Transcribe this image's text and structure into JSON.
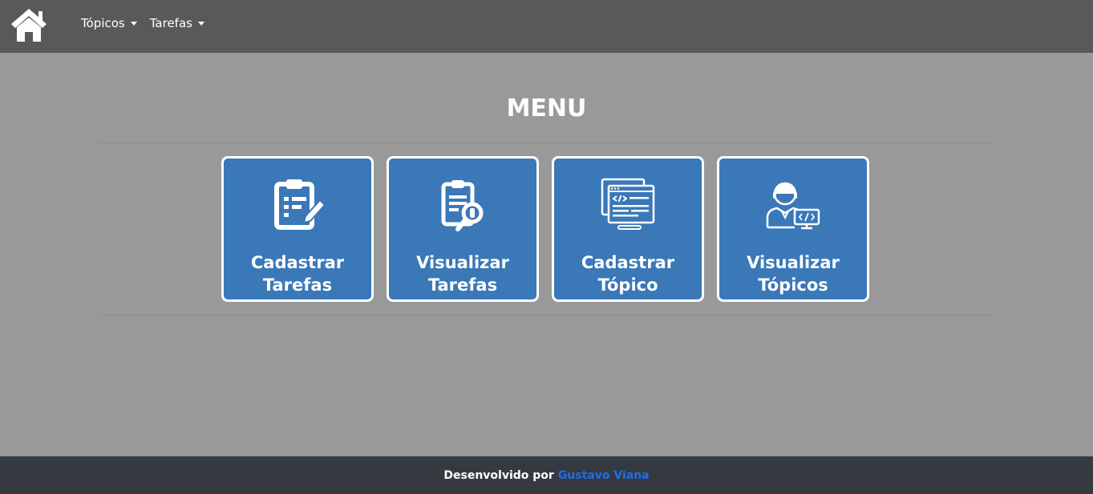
{
  "navbar": {
    "home_icon": "home-icon",
    "menu_items": [
      {
        "label": "Tópicos"
      },
      {
        "label": "Tarefas"
      }
    ]
  },
  "main": {
    "title": "MENU",
    "cards": [
      {
        "line1": "Cadastrar",
        "line2": "Tarefas",
        "icon": "clipboard-edit-icon"
      },
      {
        "line1": "Visualizar",
        "line2": "Tarefas",
        "icon": "clipboard-search-icon"
      },
      {
        "line1": "Cadastrar",
        "line2": "Tópico",
        "icon": "code-window-icon"
      },
      {
        "line1": "Visualizar",
        "line2": "Tópicos",
        "icon": "developer-icon"
      }
    ]
  },
  "footer": {
    "text": "Desenvolvido por",
    "author": "Gustavo Viana"
  },
  "colors": {
    "navbar": "#595959",
    "background": "#999999",
    "card": "#3a78b8",
    "footer": "#343a40",
    "link": "#1a6ef0"
  }
}
